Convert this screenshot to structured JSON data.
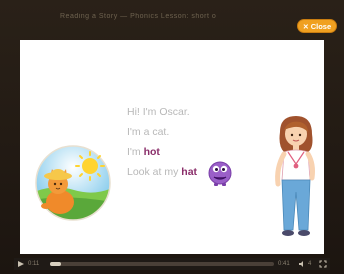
{
  "window": {
    "title": "Reading a Story — Phonics Lesson: short o"
  },
  "close_button": {
    "label": "Close",
    "icon": "close-icon"
  },
  "story": {
    "lines": [
      {
        "parts": [
          {
            "text": "Hi! I'm  Oscar.",
            "highlight": false
          }
        ]
      },
      {
        "parts": [
          {
            "text": "I'm  a  cat.",
            "highlight": false
          }
        ]
      },
      {
        "parts": [
          {
            "text": "I'm ",
            "highlight": false
          },
          {
            "text": "hot",
            "highlight": true
          }
        ]
      },
      {
        "parts": [
          {
            "text": "Look  at  my  ",
            "highlight": false
          },
          {
            "text": "hat",
            "highlight": true
          }
        ]
      }
    ]
  },
  "player": {
    "elapsed": "0:11",
    "duration": "0:41",
    "progress": 0.05,
    "volume_label": "4"
  },
  "colors": {
    "accent": "#f0a020",
    "highlight_text": "#8a2e6a",
    "story_text": "#b8b8b8"
  }
}
